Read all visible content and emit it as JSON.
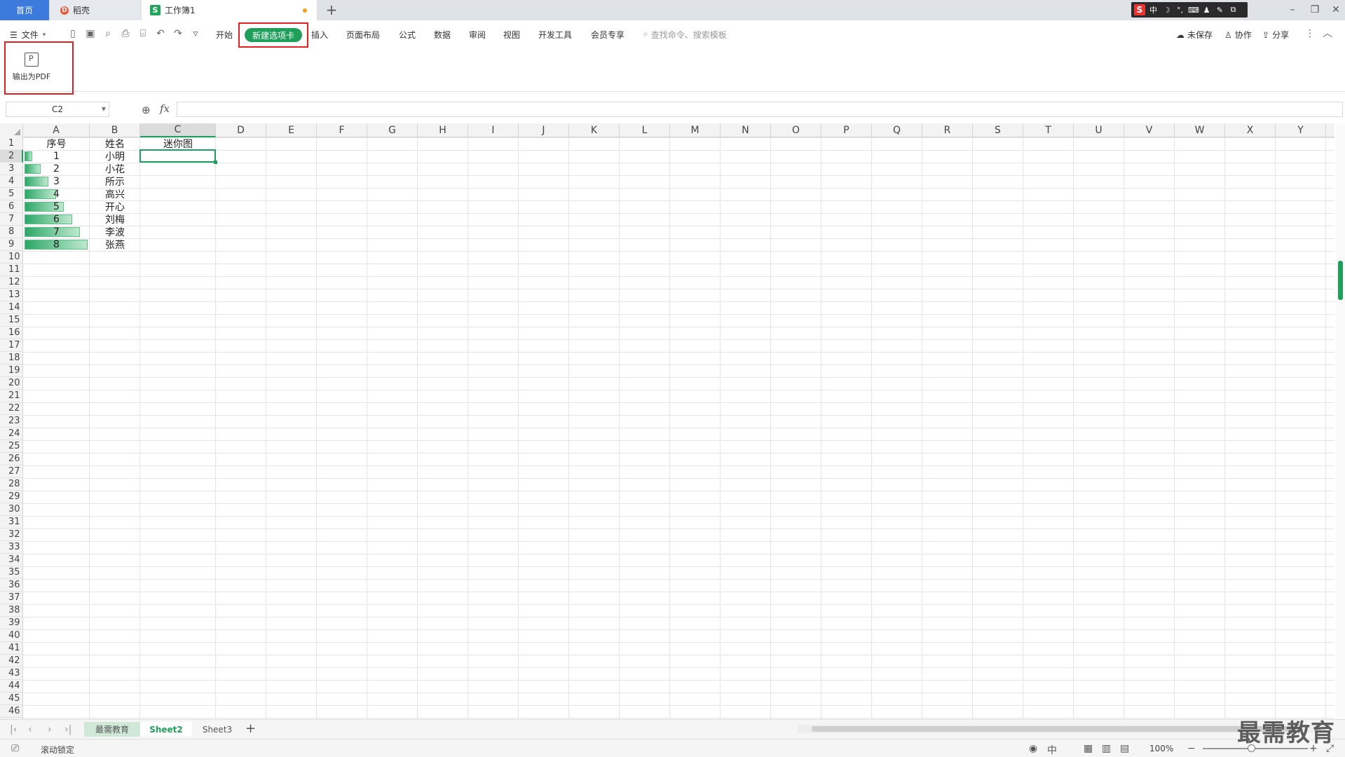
{
  "tabs": {
    "home": "首页",
    "daoke": "稻壳",
    "workbook": "工作簿1"
  },
  "ime": {
    "logo": "S",
    "items": [
      "中",
      "☽",
      "°,",
      "⌨",
      "♟",
      "✎",
      "⧉"
    ]
  },
  "menu": {
    "file": "文件",
    "items": [
      "开始",
      "新建选项卡",
      "插入",
      "页面布局",
      "公式",
      "数据",
      "审阅",
      "视图",
      "开发工具",
      "会员专享"
    ],
    "search_placeholder": "查找命令、搜索模板",
    "unsaved": "未保存",
    "collab": "协作",
    "share": "分享"
  },
  "ribbon": {
    "export_pdf": "输出为PDF"
  },
  "formula": {
    "namebox": "C2",
    "fx": "fx",
    "value": ""
  },
  "columns": [
    "A",
    "B",
    "C",
    "D",
    "E",
    "F",
    "G",
    "H",
    "I",
    "J",
    "K",
    "L",
    "M",
    "N",
    "O",
    "P",
    "Q",
    "R",
    "S",
    "T",
    "U",
    "V",
    "W",
    "X",
    "Y"
  ],
  "rows": [
    1,
    2,
    3,
    4,
    5,
    6,
    7,
    8,
    9,
    10,
    11,
    12,
    13,
    14,
    15,
    16,
    17,
    18,
    19,
    20,
    21,
    22,
    23,
    24,
    25,
    26,
    27,
    28,
    29,
    30,
    31,
    32,
    33,
    34,
    35,
    36,
    37,
    38,
    39,
    40,
    41,
    42,
    43,
    44,
    45,
    46
  ],
  "sheet_data": {
    "headers": [
      "序号",
      "姓名",
      "迷你图"
    ],
    "seq": [
      "1",
      "2",
      "3",
      "4",
      "5",
      "6",
      "7",
      "8"
    ],
    "names": [
      "小明",
      "小花",
      "所示",
      "高兴",
      "开心",
      "刘梅",
      "李波",
      "张燕"
    ],
    "databar_fraction": [
      0.125,
      0.25,
      0.375,
      0.5,
      0.625,
      0.75,
      0.875,
      1.0
    ],
    "selected_cell": "C2",
    "selected_column": "C",
    "selected_row": 2
  },
  "sheets": [
    "最需教育",
    "Sheet2",
    "Sheet3"
  ],
  "active_sheet": "Sheet2",
  "status": {
    "scroll_lock": "滚动锁定",
    "zoom": "100%",
    "zoom_fraction": 0.5
  },
  "watermark": "最需教育",
  "colors": {
    "accent": "#1fa05a",
    "highlight": "#e02020",
    "home_tab": "#3c7bdc"
  }
}
